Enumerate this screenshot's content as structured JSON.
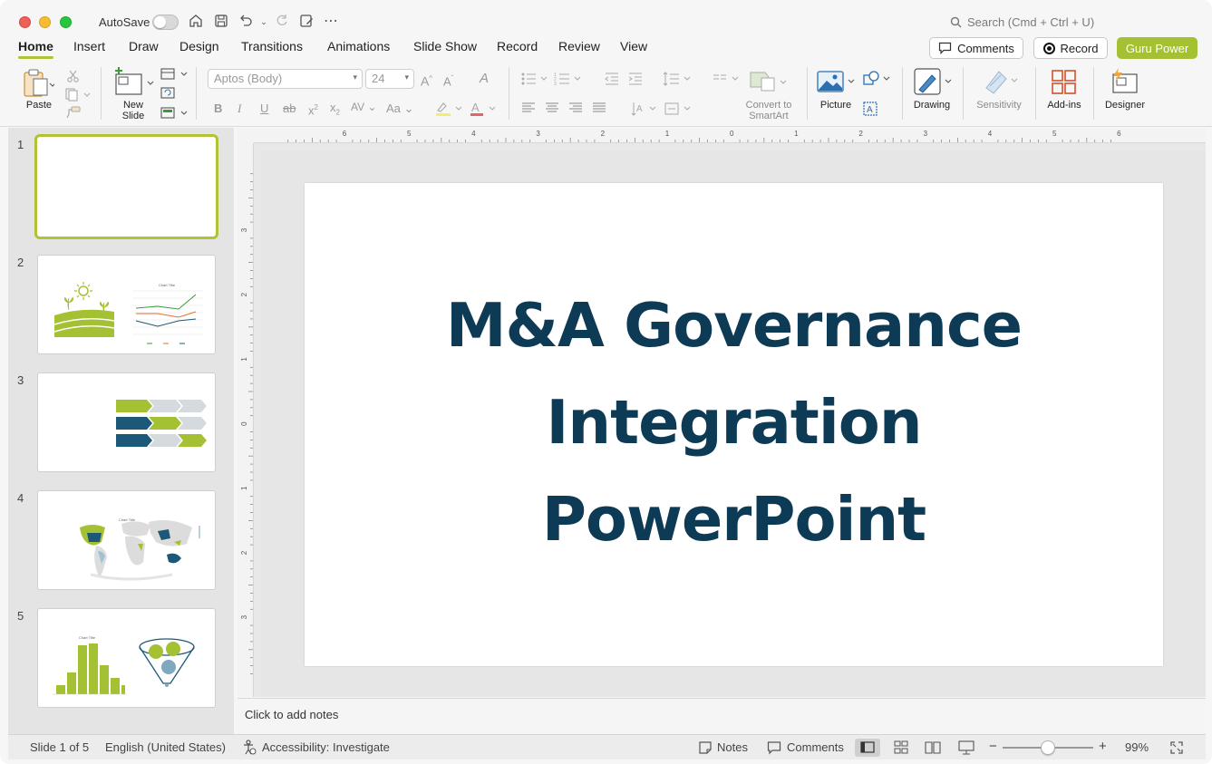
{
  "titlebar": {
    "autosave_label": "AutoSave",
    "search_placeholder": "Search (Cmd + Ctrl + U)"
  },
  "tabs": [
    "Home",
    "Insert",
    "Draw",
    "Design",
    "Transitions",
    "Animations",
    "Slide Show",
    "Record",
    "Review",
    "View"
  ],
  "header_buttons": {
    "comments": "Comments",
    "record": "Record",
    "guru": "Guru Power"
  },
  "ribbon": {
    "paste": "Paste",
    "new_slide_line1": "New",
    "new_slide_line2": "Slide",
    "font_name": "Aptos (Body)",
    "font_size": "24",
    "convert_line1": "Convert to",
    "convert_line2": "SmartArt",
    "picture": "Picture",
    "drawing": "Drawing",
    "sensitivity": "Sensitivity",
    "addins": "Add-ins",
    "designer": "Designer"
  },
  "thumbnails": {
    "numbers": [
      "1",
      "2",
      "3",
      "4",
      "5"
    ],
    "chart_title": "Chart Title"
  },
  "ruler": {
    "top_ticks": [
      "6",
      "5",
      "4",
      "3",
      "2",
      "1",
      "0",
      "1",
      "2",
      "3",
      "4",
      "5",
      "6"
    ],
    "left_ticks": [
      "3",
      "2",
      "1",
      "0",
      "1",
      "2",
      "3"
    ]
  },
  "slide": {
    "title_lines": [
      "M&A Governance",
      "Integration",
      "PowerPoint"
    ]
  },
  "notes": {
    "placeholder": "Click to add notes"
  },
  "status": {
    "slide_counter": "Slide 1 of 5",
    "language": "English (United States)",
    "accessibility": "Accessibility: Investigate",
    "notes": "Notes",
    "comments": "Comments",
    "zoom_minus": "−",
    "zoom_plus": "+",
    "zoom_value": "99%",
    "zoom_level": 0.5
  },
  "colors": {
    "accent_green": "#a4c033",
    "title_navy": "#0d3a55",
    "navy": "#1d5878",
    "light_blue": "#9dc3d5"
  }
}
